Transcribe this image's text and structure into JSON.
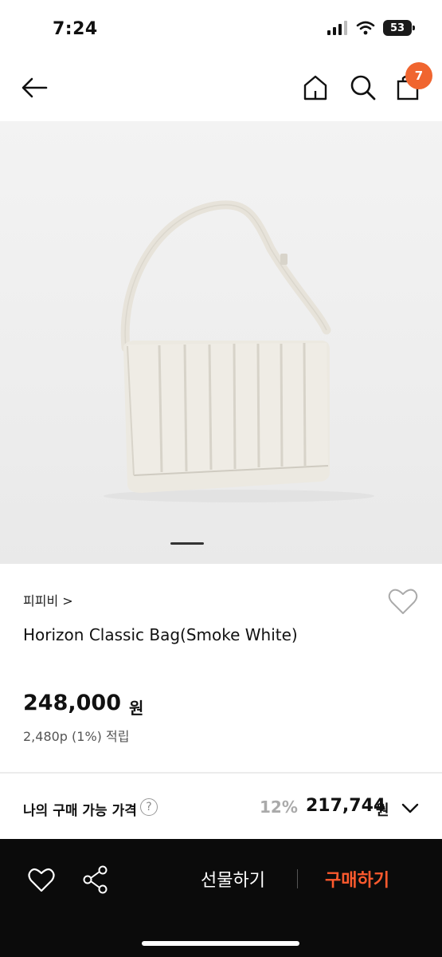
{
  "status": {
    "time": "7:24",
    "battery": "53"
  },
  "nav": {
    "back_icon": "arrow-left-icon",
    "home_icon": "home-icon",
    "search_icon": "search-icon",
    "cart_icon": "cart-icon",
    "cart_count": "7"
  },
  "product": {
    "brand": "피피비 >",
    "name": "Horizon Classic Bag(Smoke White)",
    "price": "248,000",
    "price_unit": "원",
    "points": "2,480p (1%) 적립",
    "image_page_index": 1
  },
  "my_price": {
    "label": "나의 구매 가능 가격",
    "help": "?",
    "discount": "12%",
    "price": "217,744",
    "unit": "원"
  },
  "bottom": {
    "gift_label": "선물하기",
    "buy_label": "구매하기"
  },
  "colors": {
    "accent": "#ff5a2e",
    "badge": "#f0652f",
    "bottom_bar": "#0b0b0b"
  }
}
